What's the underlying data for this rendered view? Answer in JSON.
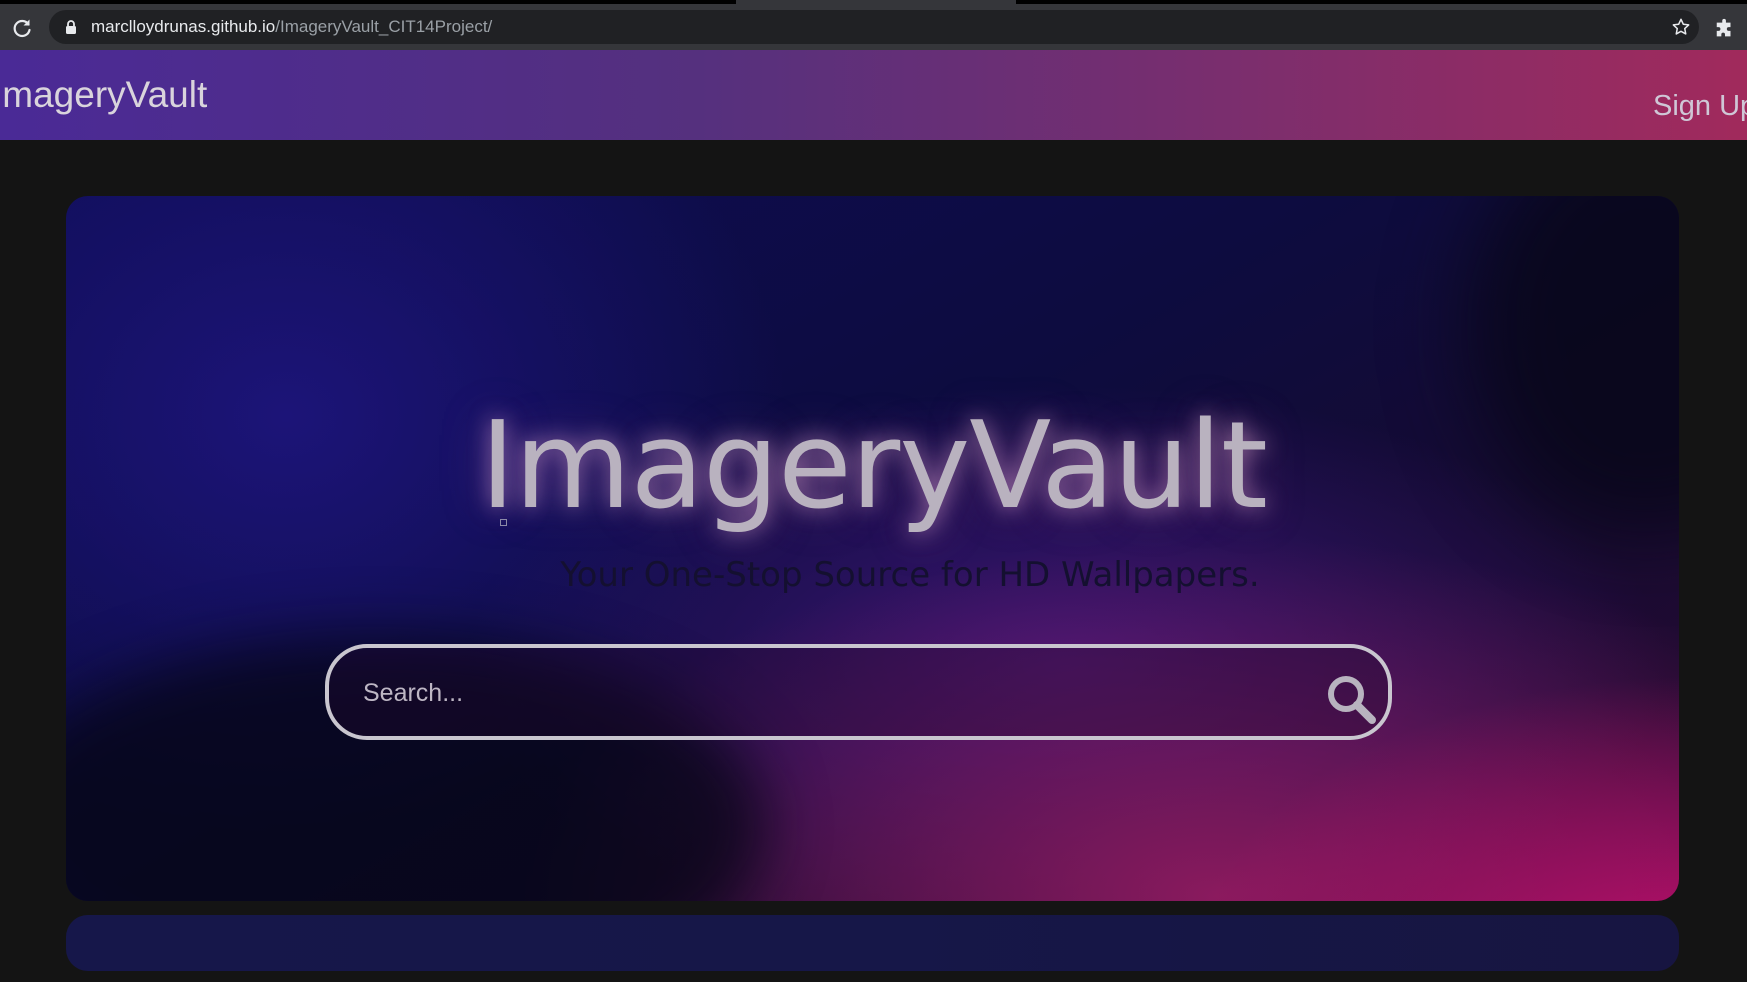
{
  "browser": {
    "url_host": "marclloydrunas.github.io",
    "url_path": "/ImageryVault_CIT14Project/",
    "icons": [
      "reload-icon",
      "lock-icon",
      "star-icon",
      "extensions-icon"
    ]
  },
  "header": {
    "brand": "ImageryVault",
    "signup_label": "Sign Up"
  },
  "hero": {
    "title": "ImageryVault",
    "subtitle": "Your One-Stop Source for HD Wallpapers.",
    "search_placeholder": "Search...",
    "search_icon": "search-icon"
  },
  "colors": {
    "header_start": "#4a2a96",
    "header_end": "#a12a5c",
    "hero_accent": "#c40f6e",
    "page_background": "#141414"
  }
}
